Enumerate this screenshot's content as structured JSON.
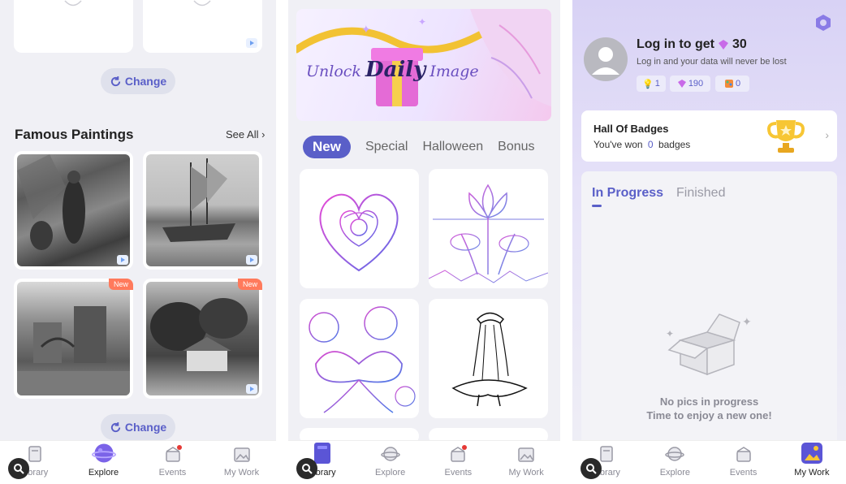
{
  "screen1": {
    "change_label": "Change",
    "section_title": "Famous Paintings",
    "see_all": "See All",
    "new_badge_1": "New",
    "new_badge_2": "New",
    "change_label_2": "Change"
  },
  "screen2": {
    "banner": {
      "word1": "Unlock",
      "word2": "Daily",
      "word3": "Image"
    },
    "tabs": [
      "New",
      "Special",
      "Halloween",
      "Bonus"
    ]
  },
  "screen3": {
    "login_title": "Log in to get",
    "login_amount": "30",
    "login_sub": "Log in and your data will never be lost",
    "stats": {
      "bulbs": "1",
      "gems": "190",
      "paints": "0"
    },
    "badges_title": "Hall Of Badges",
    "badges_sub_pre": "You've won",
    "badges_count": "0",
    "badges_sub_post": "badges",
    "tabs": [
      "In Progress",
      "Finished"
    ],
    "empty_line1": "No pics in progress",
    "empty_line2": "Time to enjoy a new one!"
  },
  "tabbar": {
    "library": "Library",
    "explore": "Explore",
    "events": "Events",
    "mywork": "My Work"
  },
  "colors": {
    "accent": "#5a5fc8",
    "badge_new": "#ff7a5c",
    "hero_bg": "#d8d2f5"
  }
}
